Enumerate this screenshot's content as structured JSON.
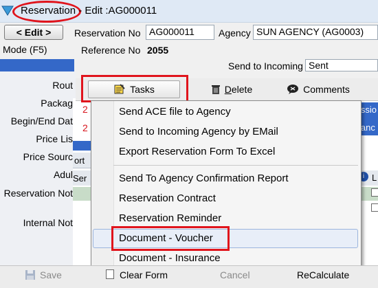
{
  "window": {
    "title_part1": "Reservation",
    "title_part2": " - Edit :AG000011"
  },
  "header": {
    "edit_button": "< Edit >",
    "mode_label": "Mode (F5)",
    "reservation_no_label": "Reservation No",
    "reservation_no_value": "AG000011",
    "agency_label": "Agency",
    "agency_value": "SUN AGENCY (AG0003)",
    "reference_no_label": "Reference No",
    "reference_no_value": "2055"
  },
  "incoming": {
    "label": "Send to Incoming",
    "value": "Sent"
  },
  "left_labels": {
    "route": "Rout",
    "package": "Packag",
    "begin_end": "Begin/End Dat",
    "price_list": "Price Lis",
    "price_source": "Price Sourc",
    "adult": "Adul",
    "reservation_note": "Reservation Not",
    "internal_note": "Internal Not"
  },
  "partial_texts": {
    "red1": "2",
    "red2": "2",
    "right1": "issio",
    "right2": "lanc",
    "sort": "ort",
    "ser": "Ser",
    "l": "L"
  },
  "toolbar": {
    "tasks": "Tasks",
    "delete": "Delete",
    "comments": "Comments"
  },
  "menu": {
    "items": [
      "Send ACE file to Agency",
      "Send to Incoming Agency by EMail",
      "Export Reservation Form To Excel",
      "Send To Agency Confirmation Report",
      "Reservation Contract",
      "Reservation Reminder",
      "Document - Voucher",
      "Document - Insurance"
    ]
  },
  "bottom": {
    "save": "Save",
    "clear_form": "Clear Form",
    "cancel": "Cancel",
    "recalculate": "ReCalculate"
  },
  "colors": {
    "highlight_red": "#e0141c",
    "band_blue": "#3468c8"
  }
}
